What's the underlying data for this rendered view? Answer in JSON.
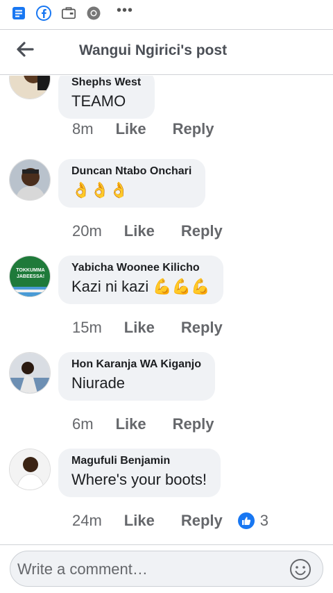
{
  "header": {
    "title": "Wangui Ngirici's post"
  },
  "comments": [
    {
      "author": "Shephs West",
      "text": "TEAMO",
      "emoji": "",
      "time": "8m",
      "like": "Like",
      "reply": "Reply"
    },
    {
      "author": "Duncan Ntabo Onchari",
      "text": "",
      "emoji": "👌👌👌",
      "time": "20m",
      "like": "Like",
      "reply": "Reply"
    },
    {
      "author": "Yabicha Woonee Kilicho",
      "text": "Kazi ni kazi",
      "emoji": "💪💪💪",
      "time": "15m",
      "like": "Like",
      "reply": "Reply",
      "avatar_text": "TOKKUMMA JABEESSA!"
    },
    {
      "author": "Hon Karanja WA Kiganjo",
      "text": "Niurade",
      "emoji": "",
      "time": "6m",
      "like": "Like",
      "reply": "Reply"
    },
    {
      "author": "Magufuli Benjamin",
      "text": "Where's your boots!",
      "emoji": "",
      "time": "24m",
      "like": "Like",
      "reply": "Reply",
      "reaction_count": "3"
    }
  ],
  "composer": {
    "placeholder": "Write a comment…"
  },
  "colors": {
    "accent": "#1877f2",
    "bubble": "#f0f2f5",
    "muted": "#65676b"
  },
  "icons": [
    "messages-icon",
    "facebook-icon",
    "briefcase-icon",
    "chrome-icon",
    "more-icon",
    "back-arrow-icon",
    "like-reaction-icon",
    "emoji-icon"
  ]
}
